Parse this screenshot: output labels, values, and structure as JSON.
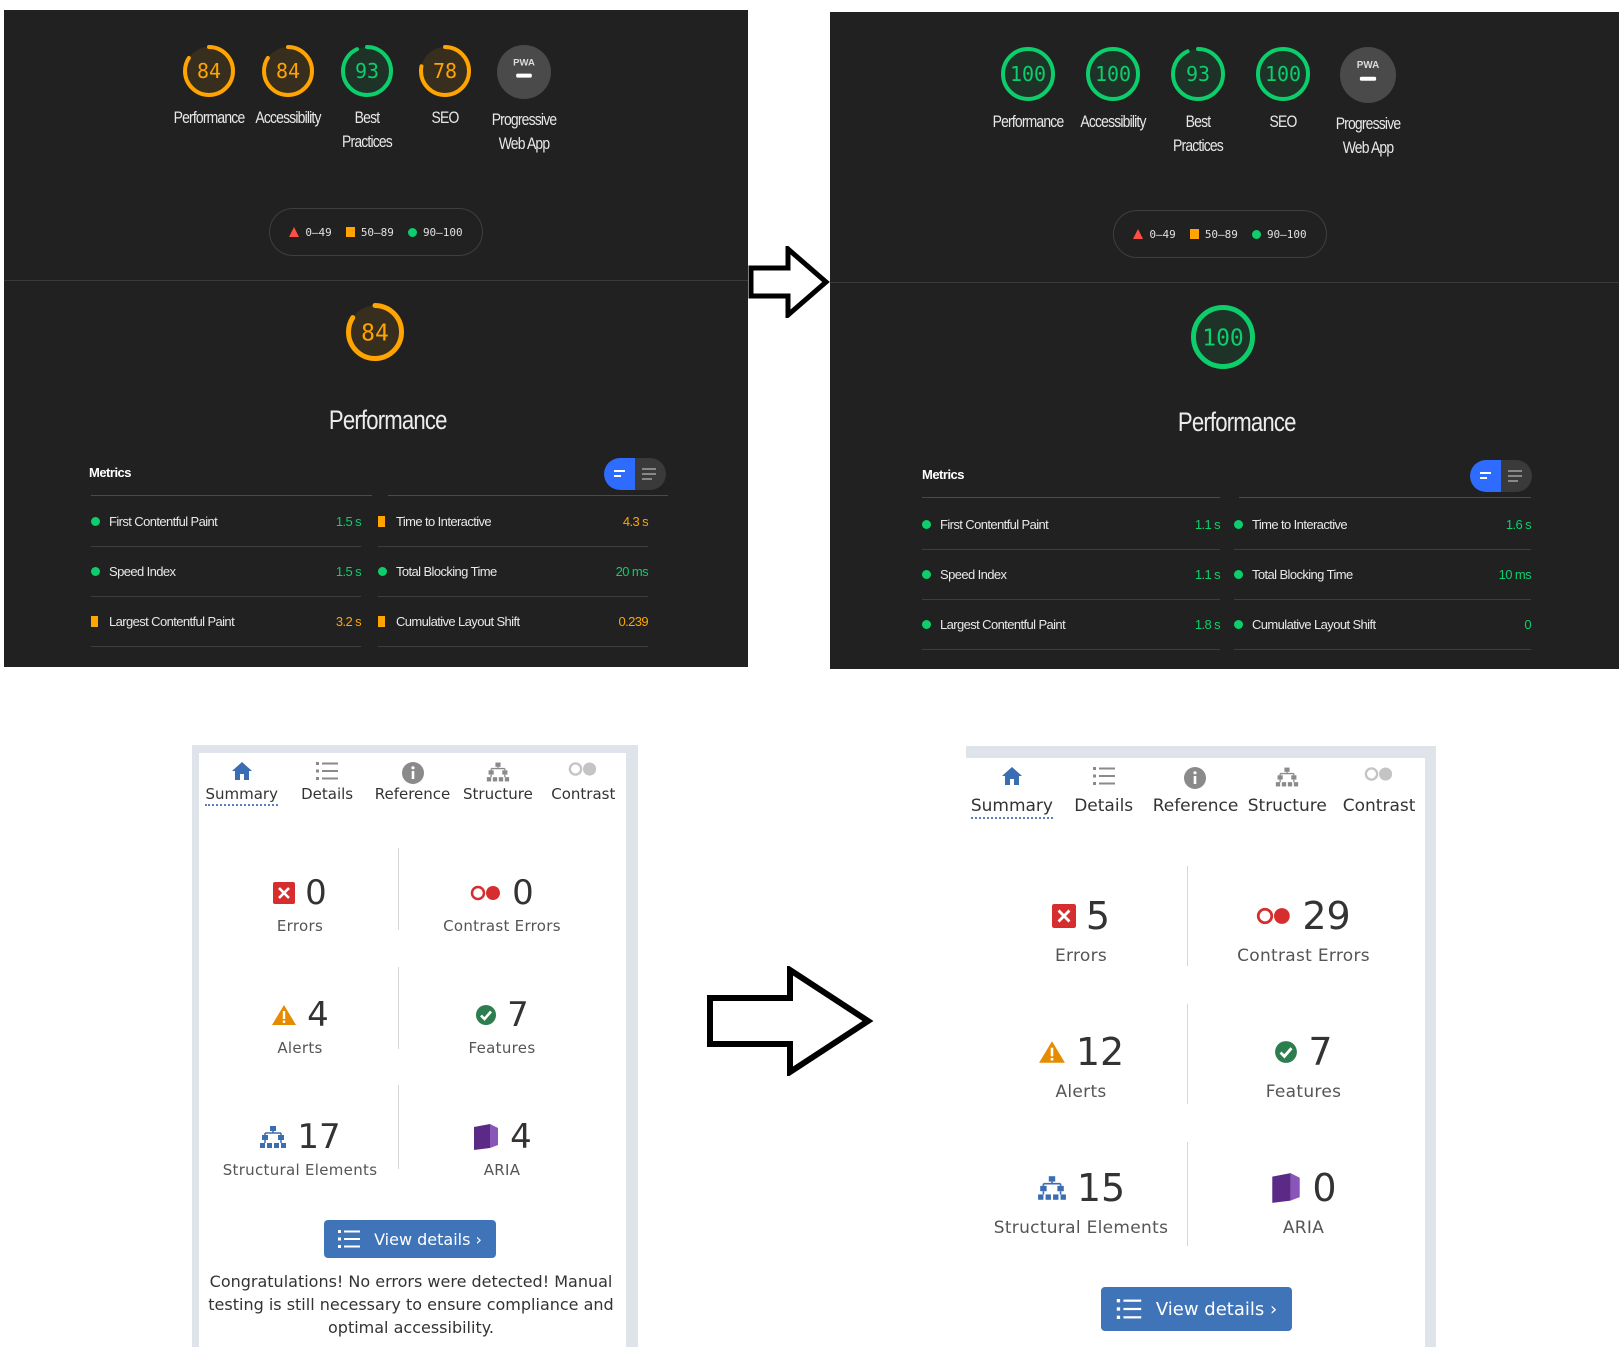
{
  "lighthouse_before": {
    "gauges": [
      {
        "label_lines": [
          "Performance"
        ],
        "score": "84",
        "value": 84,
        "color": "#ffa400"
      },
      {
        "label_lines": [
          "Accessibility"
        ],
        "score": "84",
        "value": 84,
        "color": "#ffa400"
      },
      {
        "label_lines": [
          "Best",
          "Practices"
        ],
        "score": "93",
        "value": 93,
        "color": "#0cce6b"
      },
      {
        "label_lines": [
          "SEO"
        ],
        "score": "78",
        "value": 78,
        "color": "#ffa400"
      },
      {
        "label_lines": [
          "Progressive",
          "Web App"
        ],
        "score": "PWA",
        "value": 0,
        "color": "#555555"
      }
    ],
    "legend": {
      "fail": "0–49",
      "average": "50–89",
      "pass": "90–100"
    },
    "section_score": "84",
    "section_value": 84,
    "section_color": "#ffa400",
    "section_title": "Performance",
    "metrics_heading": "Metrics",
    "metrics": [
      {
        "name": "First Contentful Paint",
        "value": "1.5 s",
        "status": "pass"
      },
      {
        "name": "Time to Interactive",
        "value": "4.3 s",
        "status": "average"
      },
      {
        "name": "Speed Index",
        "value": "1.5 s",
        "status": "pass"
      },
      {
        "name": "Total Blocking Time",
        "value": "20 ms",
        "status": "pass"
      },
      {
        "name": "Largest Contentful Paint",
        "value": "3.2 s",
        "status": "average"
      },
      {
        "name": "Cumulative Layout Shift",
        "value": "0.239",
        "status": "average"
      }
    ]
  },
  "lighthouse_after": {
    "gauges": [
      {
        "label_lines": [
          "Performance"
        ],
        "score": "100",
        "value": 100,
        "color": "#0cce6b"
      },
      {
        "label_lines": [
          "Accessibility"
        ],
        "score": "100",
        "value": 100,
        "color": "#0cce6b"
      },
      {
        "label_lines": [
          "Best",
          "Practices"
        ],
        "score": "93",
        "value": 93,
        "color": "#0cce6b"
      },
      {
        "label_lines": [
          "SEO"
        ],
        "score": "100",
        "value": 100,
        "color": "#0cce6b"
      },
      {
        "label_lines": [
          "Progressive",
          "Web App"
        ],
        "score": "PWA",
        "value": 0,
        "color": "#555555"
      }
    ],
    "legend": {
      "fail": "0–49",
      "average": "50–89",
      "pass": "90–100"
    },
    "section_score": "100",
    "section_value": 100,
    "section_color": "#0cce6b",
    "section_title": "Performance",
    "metrics_heading": "Metrics",
    "metrics": [
      {
        "name": "First Contentful Paint",
        "value": "1.1 s",
        "status": "pass"
      },
      {
        "name": "Time to Interactive",
        "value": "1.6 s",
        "status": "pass"
      },
      {
        "name": "Speed Index",
        "value": "1.1 s",
        "status": "pass"
      },
      {
        "name": "Total Blocking Time",
        "value": "10 ms",
        "status": "pass"
      },
      {
        "name": "Largest Contentful Paint",
        "value": "1.8 s",
        "status": "pass"
      },
      {
        "name": "Cumulative Layout Shift",
        "value": "0",
        "status": "pass"
      }
    ]
  },
  "status_colors": {
    "pass": "#0cce6b",
    "average": "#ffa400",
    "fail": "#ff4e42"
  },
  "wave_before": {
    "tabs": [
      {
        "label": "Summary",
        "icon": "home-icon",
        "active": true
      },
      {
        "label": "Details",
        "icon": "list-icon",
        "active": false
      },
      {
        "label": "Reference",
        "icon": "info-icon",
        "active": false
      },
      {
        "label": "Structure",
        "icon": "structure-icon",
        "active": false
      },
      {
        "label": "Contrast",
        "icon": "contrast-icon",
        "active": false
      }
    ],
    "stats": {
      "errors": {
        "count": "0",
        "label": "Errors"
      },
      "contrast_errors": {
        "count": "0",
        "label": "Contrast Errors"
      },
      "alerts": {
        "count": "4",
        "label": "Alerts"
      },
      "features": {
        "count": "7",
        "label": "Features"
      },
      "structural": {
        "count": "17",
        "label": "Structural Elements"
      },
      "aria": {
        "count": "4",
        "label": "ARIA"
      }
    },
    "view_details": "View details ›",
    "message": "Congratulations! No errors were detected! Manual testing is still necessary to ensure compliance and optimal accessibility."
  },
  "wave_after": {
    "tabs": [
      {
        "label": "Summary",
        "icon": "home-icon",
        "active": true
      },
      {
        "label": "Details",
        "icon": "list-icon",
        "active": false
      },
      {
        "label": "Reference",
        "icon": "info-icon",
        "active": false
      },
      {
        "label": "Structure",
        "icon": "structure-icon",
        "active": false
      },
      {
        "label": "Contrast",
        "icon": "contrast-icon",
        "active": false
      }
    ],
    "stats": {
      "errors": {
        "count": "5",
        "label": "Errors"
      },
      "contrast_errors": {
        "count": "29",
        "label": "Contrast Errors"
      },
      "alerts": {
        "count": "12",
        "label": "Alerts"
      },
      "features": {
        "count": "7",
        "label": "Features"
      },
      "structural": {
        "count": "15",
        "label": "Structural Elements"
      },
      "aria": {
        "count": "0",
        "label": "ARIA"
      }
    },
    "view_details": "View details ›"
  }
}
